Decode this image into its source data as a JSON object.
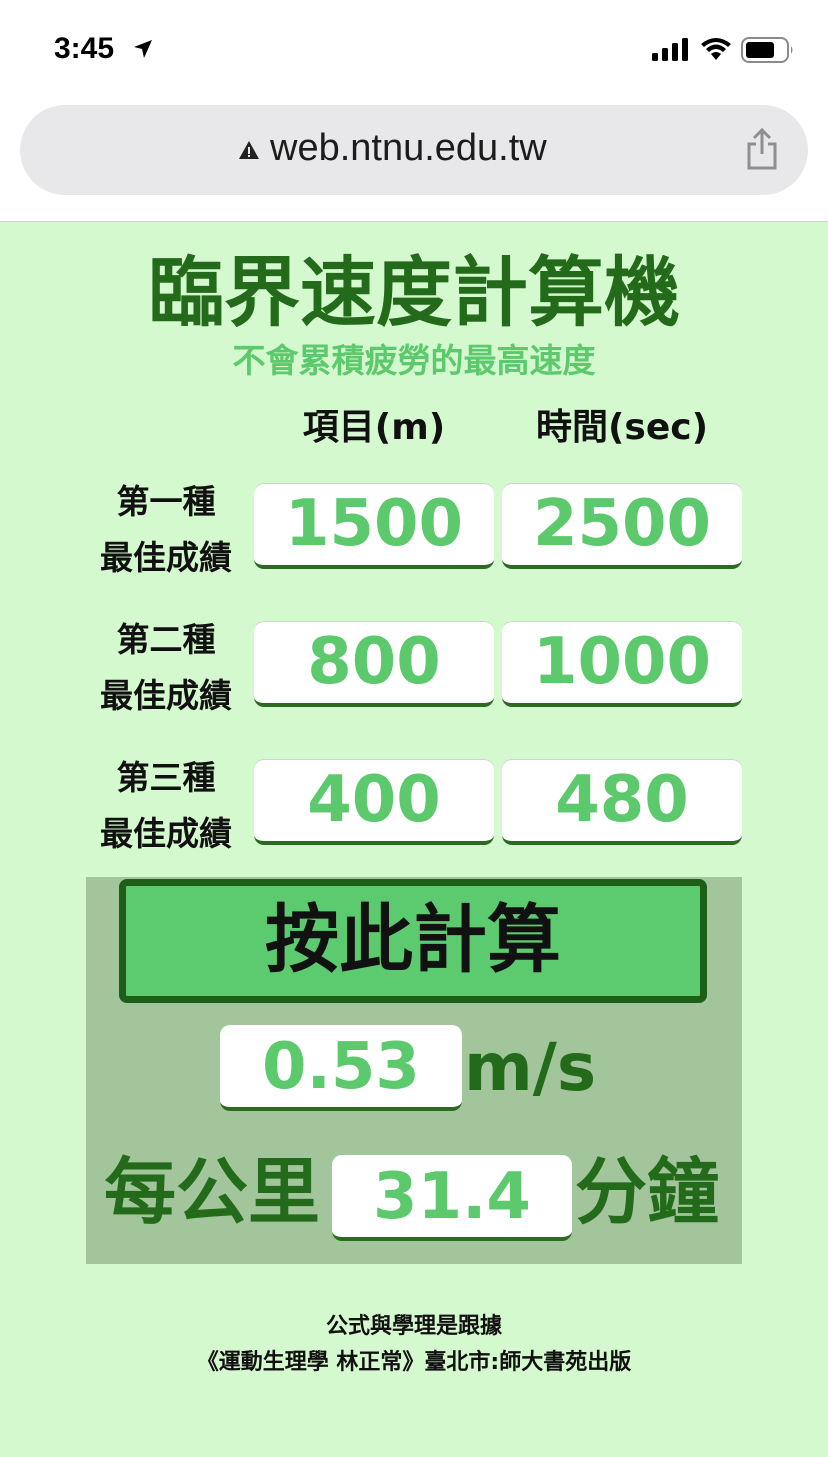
{
  "status_bar": {
    "time": "3:45"
  },
  "browser": {
    "url": "web.ntnu.edu.tw"
  },
  "page": {
    "title": "臨界速度計算機",
    "subtitle": "不會累積疲勞的最高速度",
    "col_distance": "項目(m)",
    "col_time": "時間(sec)",
    "rows": [
      {
        "label_line1": "第一種",
        "label_line2": "最佳成績",
        "distance": "1500",
        "time": "2500"
      },
      {
        "label_line1": "第二種",
        "label_line2": "最佳成績",
        "distance": "800",
        "time": "1000"
      },
      {
        "label_line1": "第三種",
        "label_line2": "最佳成績",
        "distance": "400",
        "time": "480"
      }
    ],
    "calc_button": "按此計算",
    "result_speed": "0.53",
    "speed_unit": "m/s",
    "per_km_label": "每公里",
    "pace_value": "31.4",
    "minutes_label": "分鐘",
    "footer_line1": "公式與學理是跟據",
    "footer_line2": "《運動生理學 林正常》臺北市:師大書苑出版"
  },
  "colors": {
    "background": "#d5f9cf",
    "accent_dark": "#236b1a",
    "accent_light": "#5cc96c",
    "panel": "#a3c59c"
  }
}
